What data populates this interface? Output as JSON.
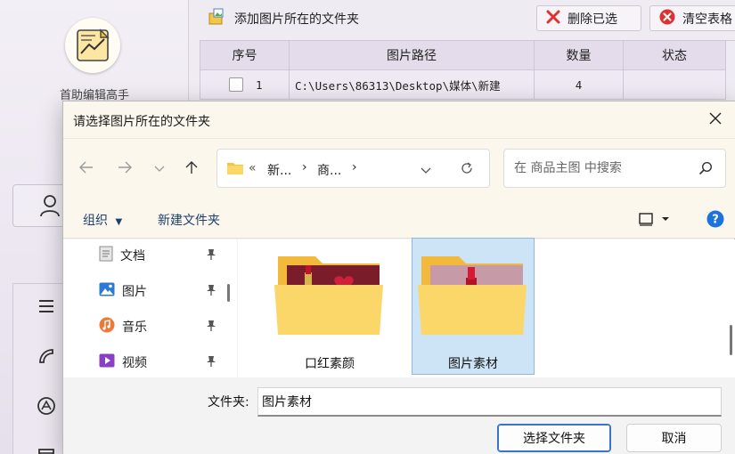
{
  "app": {
    "name": "首助编辑高手",
    "toolbar": {
      "add_folder": "添加图片所在的文件夹",
      "delete_selected": "删除已选",
      "clear_table": "清空表格"
    },
    "table": {
      "columns": [
        "序号",
        "图片路径",
        "数量",
        "状态"
      ],
      "rows": [
        {
          "index": "1",
          "path": "C:\\Users\\86313\\Desktop\\媒体\\新建",
          "count": "4",
          "status": ""
        }
      ]
    }
  },
  "dialog": {
    "title": "请选择图片所在的文件夹",
    "address": {
      "prefix": "«",
      "segments": [
        "新...",
        "商..."
      ]
    },
    "search_placeholder": "在 商品主图 中搜索",
    "commands": {
      "organize": "组织",
      "new_folder": "新建文件夹"
    },
    "nav_items": [
      {
        "label": "文档",
        "icon": "document-icon"
      },
      {
        "label": "图片",
        "icon": "pictures-icon"
      },
      {
        "label": "音乐",
        "icon": "music-icon"
      },
      {
        "label": "视频",
        "icon": "video-icon"
      }
    ],
    "folders": [
      {
        "label": "口红素颜",
        "selected": false
      },
      {
        "label": "图片素材",
        "selected": true
      }
    ],
    "folder_field_label": "文件夹:",
    "folder_field_value": "图片素材",
    "select_button": "选择文件夹",
    "cancel_button": "取消"
  },
  "colors": {
    "accent": "#3d73c4",
    "selection": "#cde3f6",
    "folder": "#f8cf5a",
    "help": "#1e73d8",
    "delete": "#e03030"
  }
}
